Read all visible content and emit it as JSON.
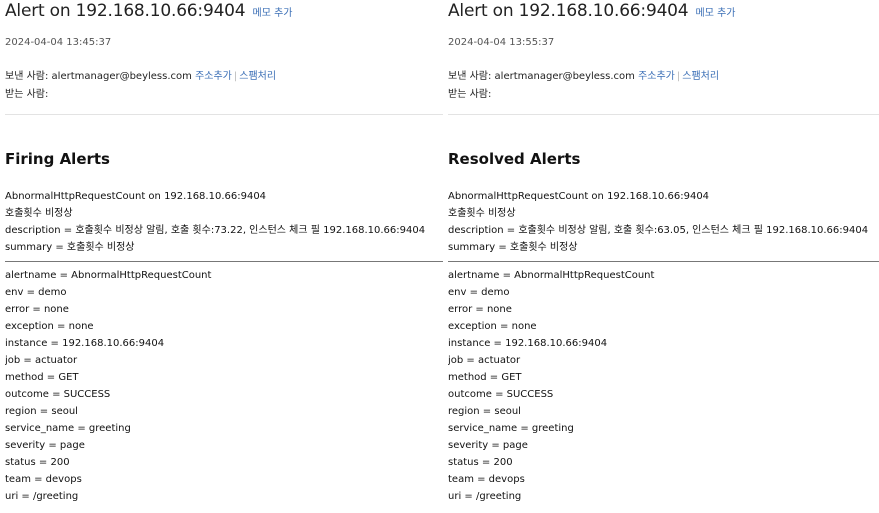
{
  "left": {
    "subject": "Alert on 192.168.10.66:9404",
    "memo_link": "메모 추가",
    "date": "2024-04-04 13:45:37",
    "sender_label": "보낸 사람:",
    "sender_email": "alertmanager@beyless.com",
    "add_address_link": "주소추가",
    "spam_link": "스팸처리",
    "recipient_label": "받는 사람:",
    "section_title": "Firing Alerts",
    "summary_lines": [
      "AbnormalHttpRequestCount on 192.168.10.66:9404",
      "호출횟수 비정상",
      "description = 호출횟수 비정상 알림, 호출 횟수:73.22, 인스턴스 체크 필 192.168.10.66:9404",
      "summary = 호출횟수 비정상"
    ],
    "labels": [
      "alertname = AbnormalHttpRequestCount",
      "env = demo",
      "error = none",
      "exception = none",
      "instance = 192.168.10.66:9404",
      "job = actuator",
      "method = GET",
      "outcome = SUCCESS",
      "region = seoul",
      "service_name = greeting",
      "severity = page",
      "status = 200",
      "team = devops",
      "uri = /greeting"
    ]
  },
  "right": {
    "subject": "Alert on 192.168.10.66:9404",
    "memo_link": "메모 추가",
    "date": "2024-04-04 13:55:37",
    "sender_label": "보낸 사람:",
    "sender_email": "alertmanager@beyless.com",
    "add_address_link": "주소추가",
    "spam_link": "스팸처리",
    "recipient_label": "받는 사람:",
    "section_title": "Resolved Alerts",
    "summary_lines": [
      "AbnormalHttpRequestCount on 192.168.10.66:9404",
      "호출횟수 비정상",
      "description = 호출횟수 비정상 알림, 호출 횟수:63.05, 인스턴스 체크 필 192.168.10.66:9404",
      "summary = 호출횟수 비정상"
    ],
    "labels": [
      "alertname = AbnormalHttpRequestCount",
      "env = demo",
      "error = none",
      "exception = none",
      "instance = 192.168.10.66:9404",
      "job = actuator",
      "method = GET",
      "outcome = SUCCESS",
      "region = seoul",
      "service_name = greeting",
      "severity = page",
      "status = 200",
      "team = devops",
      "uri = /greeting"
    ]
  },
  "colors": {
    "link": "#3b6fb6",
    "divider": "#777777"
  }
}
